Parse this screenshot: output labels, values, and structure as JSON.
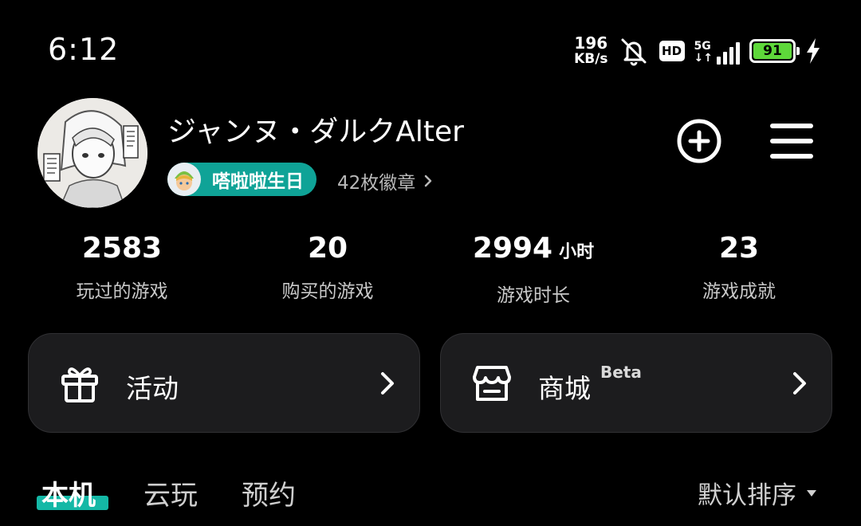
{
  "status_bar": {
    "time": "6:12",
    "net_speed_value": "196",
    "net_speed_unit": "KB/s",
    "hd_label": "HD",
    "signal_label_top": "5G",
    "signal_label_bottom": "↓↑",
    "battery_level": "91",
    "icons": [
      "bell-muted-icon",
      "hd-icon",
      "signal-icon",
      "battery-icon",
      "charging-bolt-icon"
    ]
  },
  "profile": {
    "username": "ジャンヌ・ダルクAlter",
    "badge_name": "嗒啦啦生日",
    "badge_count": "42枚徽章",
    "actions": [
      "add-circle-icon",
      "menu-icon"
    ]
  },
  "stats": [
    {
      "value": "2583",
      "unit": "",
      "label": "玩过的游戏"
    },
    {
      "value": "20",
      "unit": "",
      "label": "购买的游戏"
    },
    {
      "value": "2994",
      "unit": "小时",
      "label": "游戏时长"
    },
    {
      "value": "23",
      "unit": "",
      "label": "游戏成就"
    }
  ],
  "cards": [
    {
      "label": "活动",
      "tag": "",
      "icon": "gift-icon"
    },
    {
      "label": "商城",
      "tag": "Beta",
      "icon": "store-icon"
    }
  ],
  "tabs": [
    {
      "label": "本机",
      "active": true
    },
    {
      "label": "云玩",
      "active": false
    },
    {
      "label": "预约",
      "active": false
    }
  ],
  "sort": {
    "label": "默认排序"
  },
  "colors": {
    "background": "#000000",
    "card_background": "#1c1c1e",
    "accent_teal": "#0fa397",
    "battery_green": "#5ed83a"
  }
}
